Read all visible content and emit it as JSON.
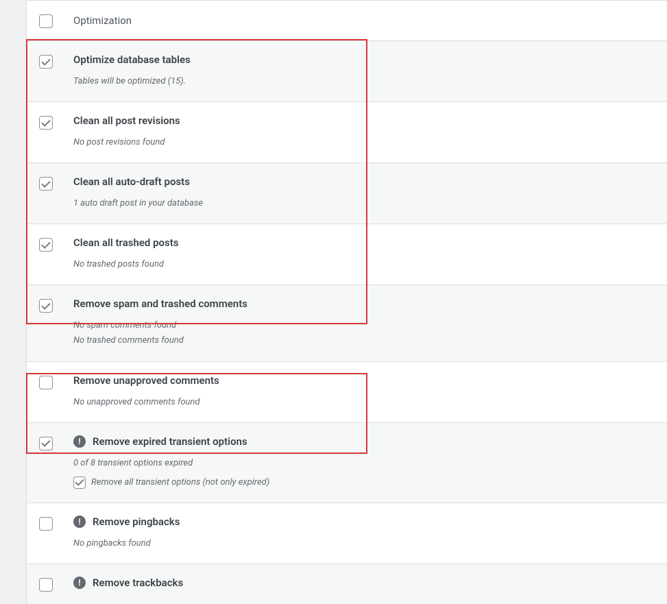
{
  "header": {
    "title": "Optimization"
  },
  "rows": [
    {
      "checked": true,
      "title": "Optimize database tables",
      "desc": [
        "Tables will be optimized (15)."
      ],
      "striped": true,
      "info": false
    },
    {
      "checked": true,
      "title": "Clean all post revisions",
      "desc": [
        "No post revisions found"
      ],
      "striped": false,
      "info": false
    },
    {
      "checked": true,
      "title": "Clean all auto-draft posts",
      "desc": [
        "1 auto draft post in your database"
      ],
      "striped": true,
      "info": false
    },
    {
      "checked": true,
      "title": "Clean all trashed posts",
      "desc": [
        "No trashed posts found"
      ],
      "striped": false,
      "info": false
    },
    {
      "checked": true,
      "title": "Remove spam and trashed comments",
      "desc": [
        "No spam comments found",
        "No trashed comments found"
      ],
      "striped": true,
      "info": false
    },
    {
      "checked": false,
      "title": "Remove unapproved comments",
      "desc": [
        "No unapproved comments found"
      ],
      "striped": false,
      "info": false
    },
    {
      "checked": true,
      "title": "Remove expired transient options",
      "desc": [
        "0 of 8 transient options expired"
      ],
      "striped": true,
      "info": true,
      "subcheck": {
        "checked": true,
        "label": "Remove all transient options (not only expired)"
      }
    },
    {
      "checked": false,
      "title": "Remove pingbacks",
      "desc": [
        "No pingbacks found"
      ],
      "striped": false,
      "info": true
    },
    {
      "checked": false,
      "title": "Remove trackbacks",
      "desc": [],
      "striped": true,
      "info": true
    }
  ]
}
